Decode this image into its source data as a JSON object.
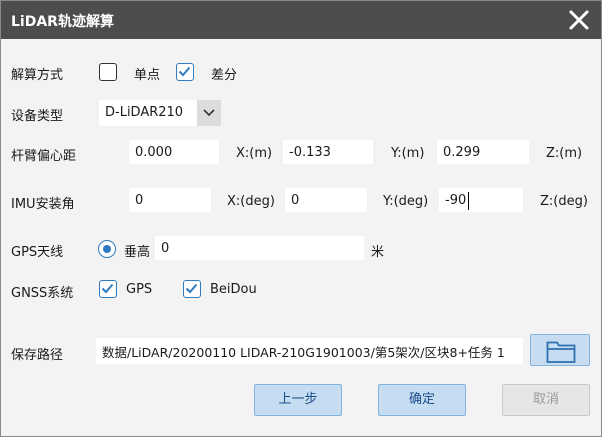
{
  "window": {
    "title": "LiDAR轨迹解算"
  },
  "solve_mode": {
    "label": "解算方式",
    "single_label": "单点",
    "single_checked": false,
    "diff_label": "差分",
    "diff_checked": true
  },
  "device": {
    "label": "设备类型",
    "selected": "D-LiDAR210"
  },
  "lever_arm": {
    "label": "杆臂偏心距",
    "x_value": "0.000",
    "x_label": "X:(m)",
    "y_value": "-0.133",
    "y_label": "Y:(m)",
    "z_value": "0.299",
    "z_label": "Z:(m)"
  },
  "imu": {
    "label": "IMU安装角",
    "x_value": "0",
    "x_label": "X:(deg)",
    "y_value": "0",
    "y_label": "Y:(deg)",
    "z_value": "-90",
    "z_label": "Z:(deg)"
  },
  "gps_antenna": {
    "label": "GPS天线",
    "mode_label": "垂高",
    "height_value": "0",
    "unit": "米"
  },
  "gnss": {
    "label": "GNSS系统",
    "gps_label": "GPS",
    "gps_checked": true,
    "beidou_label": "BeiDou",
    "beidou_checked": true
  },
  "save_path": {
    "label": "保存路径",
    "value": "数据/LiDAR/20200110 LIDAR-210G1901003/第5架次/区块8+任务 1"
  },
  "buttons": {
    "prev": "上一步",
    "ok": "确定",
    "cancel": "取消"
  },
  "colors": {
    "titlebar": "#4d4d4d",
    "accent": "#2e7bbf",
    "button_bg": "#c5dcf1"
  }
}
